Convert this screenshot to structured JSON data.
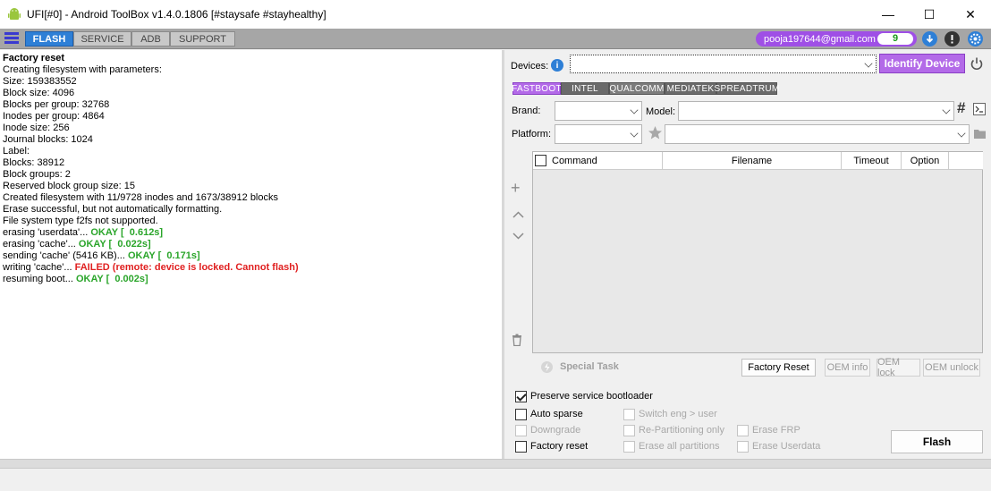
{
  "window": {
    "title": "UFI[#0] - Android ToolBox v1.4.0.1806 [#staysafe #stayhealthy]",
    "minimize": "—",
    "maximize": "☐",
    "close": "✕"
  },
  "tabs": [
    {
      "label": "FLASH"
    },
    {
      "label": "SERVICE"
    },
    {
      "label": "ADB"
    },
    {
      "label": "SUPPORT"
    }
  ],
  "account": {
    "email": "pooja197644@gmail.com",
    "count": "9"
  },
  "log": {
    "header": "Factory reset",
    "lines": [
      "Creating filesystem with parameters:",
      "Size: 159383552",
      "Block size: 4096",
      "Blocks per group: 32768",
      "Inodes per group: 4864",
      "Inode size: 256",
      "Journal blocks: 1024",
      "Label:",
      "Blocks: 38912",
      "Block groups: 2",
      "Reserved block group size: 15",
      "Created filesystem with 11/9728 inodes and 1673/38912 blocks",
      "Erase successful, but not automatically formatting.",
      "File system type f2fs not supported."
    ],
    "status_lines": [
      {
        "text": "erasing 'userdata'... ",
        "result": "OKAY [  0.612s]",
        "kind": "ok"
      },
      {
        "text": "erasing 'cache'... ",
        "result": "OKAY [  0.022s]",
        "kind": "ok"
      },
      {
        "text": "sending 'cache' (5416 KB)... ",
        "result": "OKAY [  0.171s]",
        "kind": "ok"
      },
      {
        "text": "writing 'cache'... ",
        "result": "FAILED (remote: device is locked. Cannot flash)",
        "kind": "fail"
      },
      {
        "text": "resuming boot... ",
        "result": "OKAY [  0.002s]",
        "kind": "ok"
      }
    ]
  },
  "devices": {
    "label": "Devices:",
    "identify_label": "Identify Device"
  },
  "subtabs": [
    {
      "label": "FASTBOOT"
    },
    {
      "label": "INTEL"
    },
    {
      "label": "QUALCOMM"
    },
    {
      "label": "MEDIATEK"
    },
    {
      "label": "SPREADTRUM"
    }
  ],
  "filters": {
    "brand_label": "Brand:",
    "model_label": "Model:",
    "platform_label": "Platform:",
    "hash": "#"
  },
  "table": {
    "columns": [
      "Command",
      "Filename",
      "Timeout",
      "Option"
    ]
  },
  "actions": {
    "special_task": "Special Task",
    "factory_reset": "Factory Reset",
    "oem_info": "OEM info",
    "oem_lock": "OEM lock",
    "oem_unlock": "OEM unlock",
    "flash": "Flash"
  },
  "options": {
    "preserve": "Preserve service bootloader",
    "auto_sparse": "Auto sparse",
    "downgrade": "Downgrade",
    "factory_reset": "Factory reset",
    "switch_eng": "Switch eng > user",
    "repartition": "Re-Partitioning only",
    "erase_all": "Erase all partitions",
    "erase_frp": "Erase FRP",
    "erase_userdata": "Erase Userdata"
  },
  "colors": {
    "accent": "#2e7fd6",
    "purple": "#b36ae8",
    "ok": "#2aa52a",
    "fail": "#e02020"
  }
}
